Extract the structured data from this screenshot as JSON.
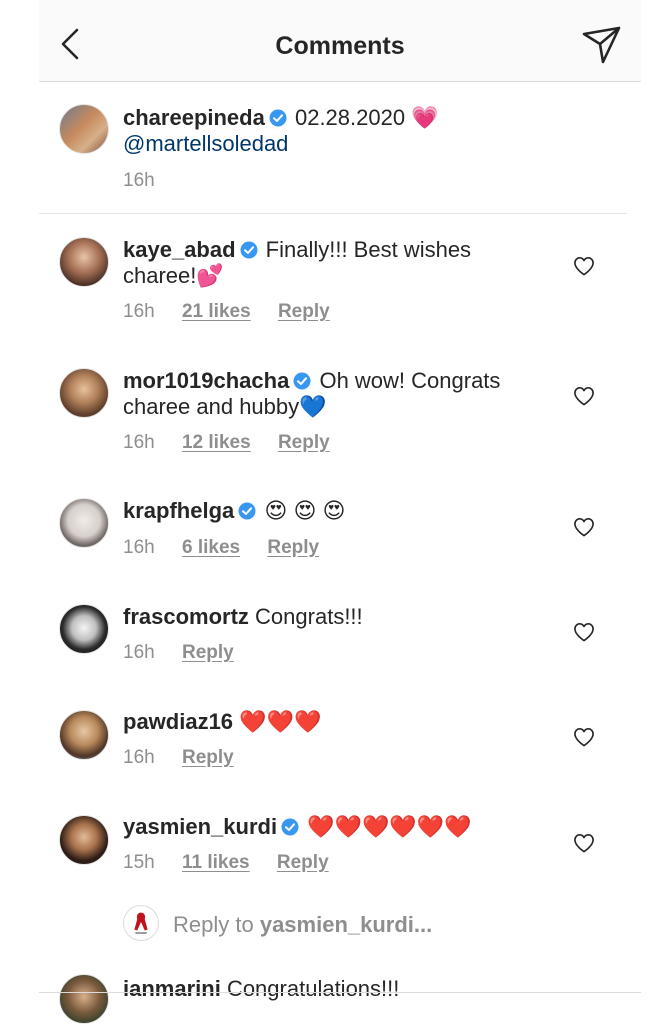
{
  "header": {
    "title": "Comments"
  },
  "colors": {
    "accent_blue": "#3897f0",
    "heart_red": "#ed4956",
    "text": "#262626",
    "muted": "#8e8e8e",
    "mention": "#00376b"
  },
  "caption": {
    "username": "chareepineda",
    "text": "02.28.2020",
    "mention": "@martellsoledad",
    "time": "16h",
    "emoji": "💗"
  },
  "comments": [
    {
      "username": "kaye_abad",
      "verified": true,
      "text_line1": "Finally!!! Best wishes",
      "text_line2": "charee!💕",
      "time": "16h",
      "likes": "21 likes",
      "reply": "Reply"
    },
    {
      "username": "mor1019chacha",
      "verified": true,
      "text_line1": "Oh wow! Congrats",
      "text_line2": "charee and hubby💙",
      "time": "16h",
      "likes": "12 likes",
      "reply": "Reply"
    },
    {
      "username": "krapfhelga",
      "verified": true,
      "text_line1": "😍 😍 😍",
      "time": "16h",
      "likes": "6 likes",
      "reply": "Reply"
    },
    {
      "username": "frascomortz",
      "verified": false,
      "text_line1": "Congrats!!!",
      "time": "16h",
      "reply": "Reply"
    },
    {
      "username": "pawdiaz16",
      "verified": false,
      "text_line1": "❤️❤️❤️",
      "time": "16h",
      "reply": "Reply"
    },
    {
      "username": "yasmien_kurdi",
      "verified": true,
      "text_line1": "❤️❤️❤️❤️❤️❤️",
      "time": "15h",
      "likes": "11 likes",
      "reply": "Reply"
    },
    {
      "username": "ianmarini",
      "verified": false,
      "text_line1": "Congratulations!!!"
    }
  ],
  "reply_bar": {
    "prefix": "Reply to ",
    "target": "yasmien_kurdi..."
  }
}
